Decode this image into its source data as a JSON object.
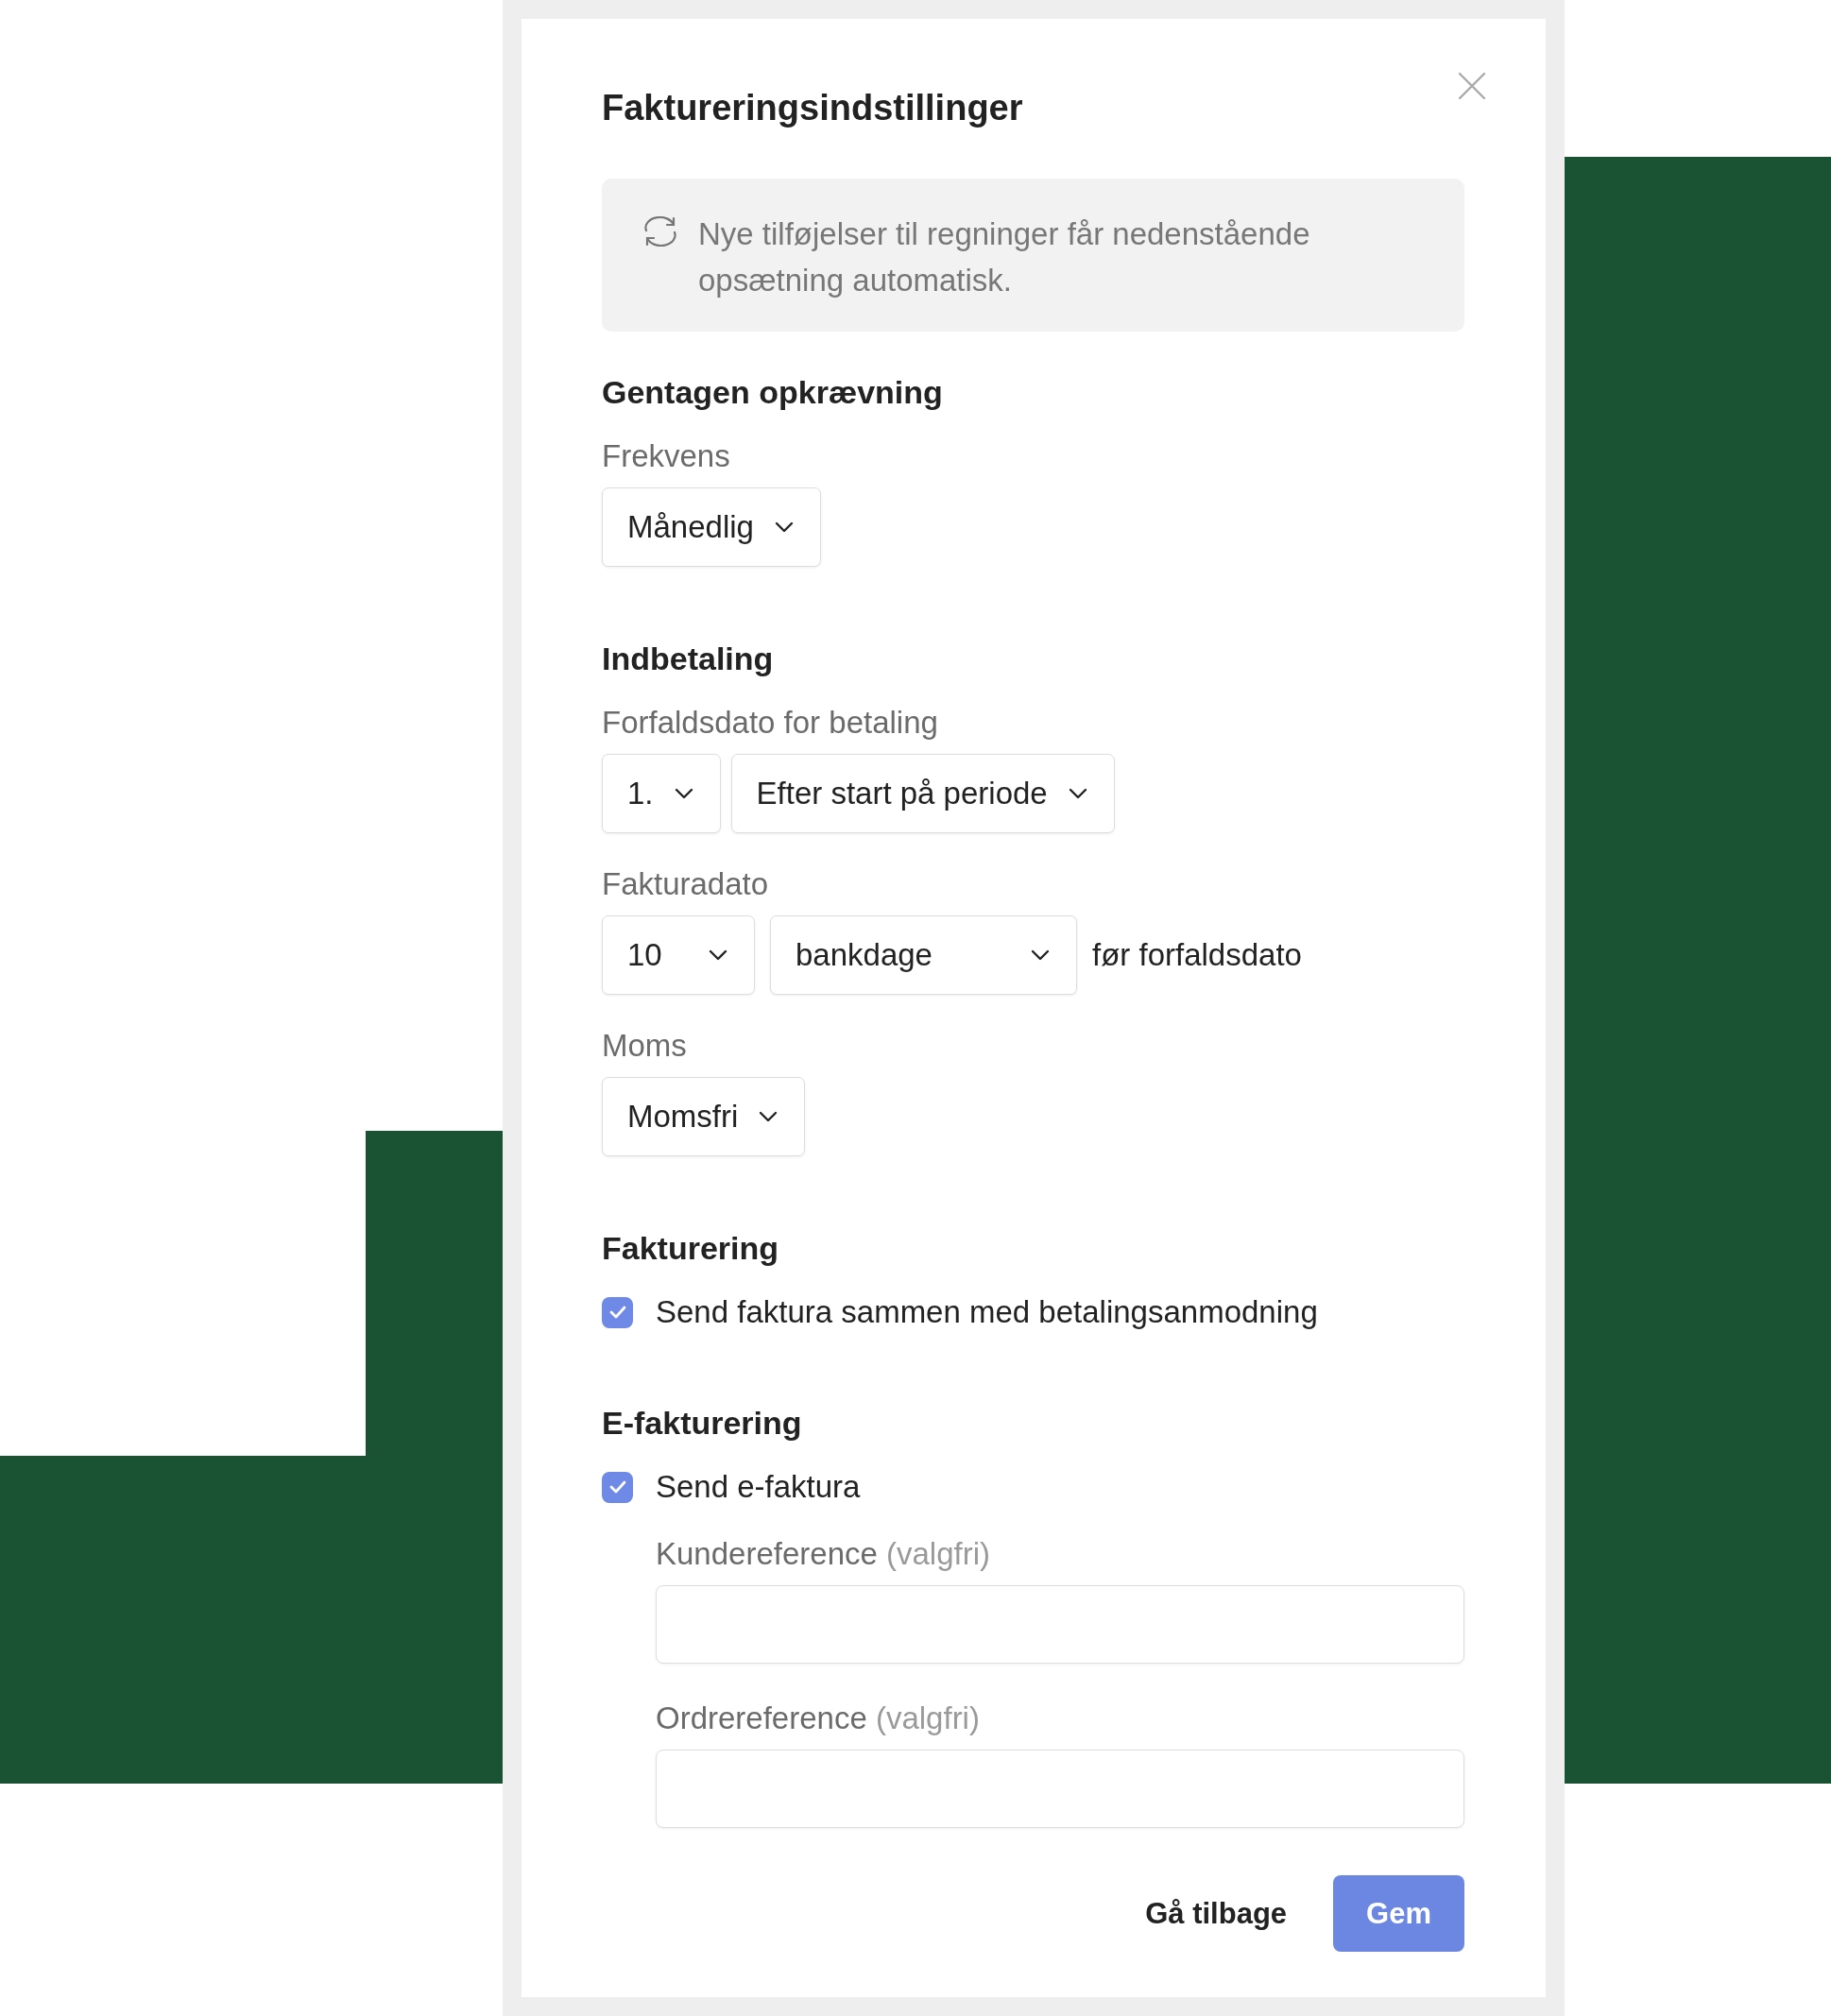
{
  "dialog": {
    "title": "Faktureringsindstillinger",
    "info": "Nye tilføjelser til regninger får nedenstående opsætning automatisk.",
    "sections": [
      {
        "heading": "Gentagen opkrævning",
        "fields": [
          {
            "kind": "select-row",
            "label": "Frekvens",
            "selects": [
              {
                "value": "Månedlig"
              }
            ]
          }
        ]
      },
      {
        "heading": "Indbetaling",
        "fields": [
          {
            "kind": "select-row",
            "label": "Forfaldsdato for betaling",
            "selects": [
              {
                "value": "1."
              },
              {
                "value": "Efter start på periode"
              }
            ]
          },
          {
            "kind": "select-row",
            "label": "Fakturadato",
            "selects": [
              {
                "value": "10"
              },
              {
                "value": "bankdage"
              }
            ],
            "suffix": "før forfaldsdato"
          },
          {
            "kind": "select-row",
            "label": "Moms",
            "selects": [
              {
                "value": "Momsfri"
              }
            ]
          }
        ]
      },
      {
        "heading": "Fakturering",
        "fields": [
          {
            "kind": "checkbox",
            "label": "Send faktura sammen med betalingsanmodning",
            "checked": true
          }
        ]
      },
      {
        "heading": "E-fakturering",
        "fields": [
          {
            "kind": "checkbox",
            "label": "Send e-faktura",
            "checked": true,
            "fields": [
              {
                "kind": "text-input",
                "label": "Kundereference",
                "note": "(valgfri)"
              },
              {
                "kind": "text-input",
                "label": "Ordrereference",
                "note": "(valgfri)"
              }
            ]
          }
        ]
      }
    ],
    "buttons": [
      {
        "label": "Gå tilbage",
        "kind": "secondary"
      },
      {
        "label": "Gem",
        "kind": "primary"
      }
    ]
  }
}
